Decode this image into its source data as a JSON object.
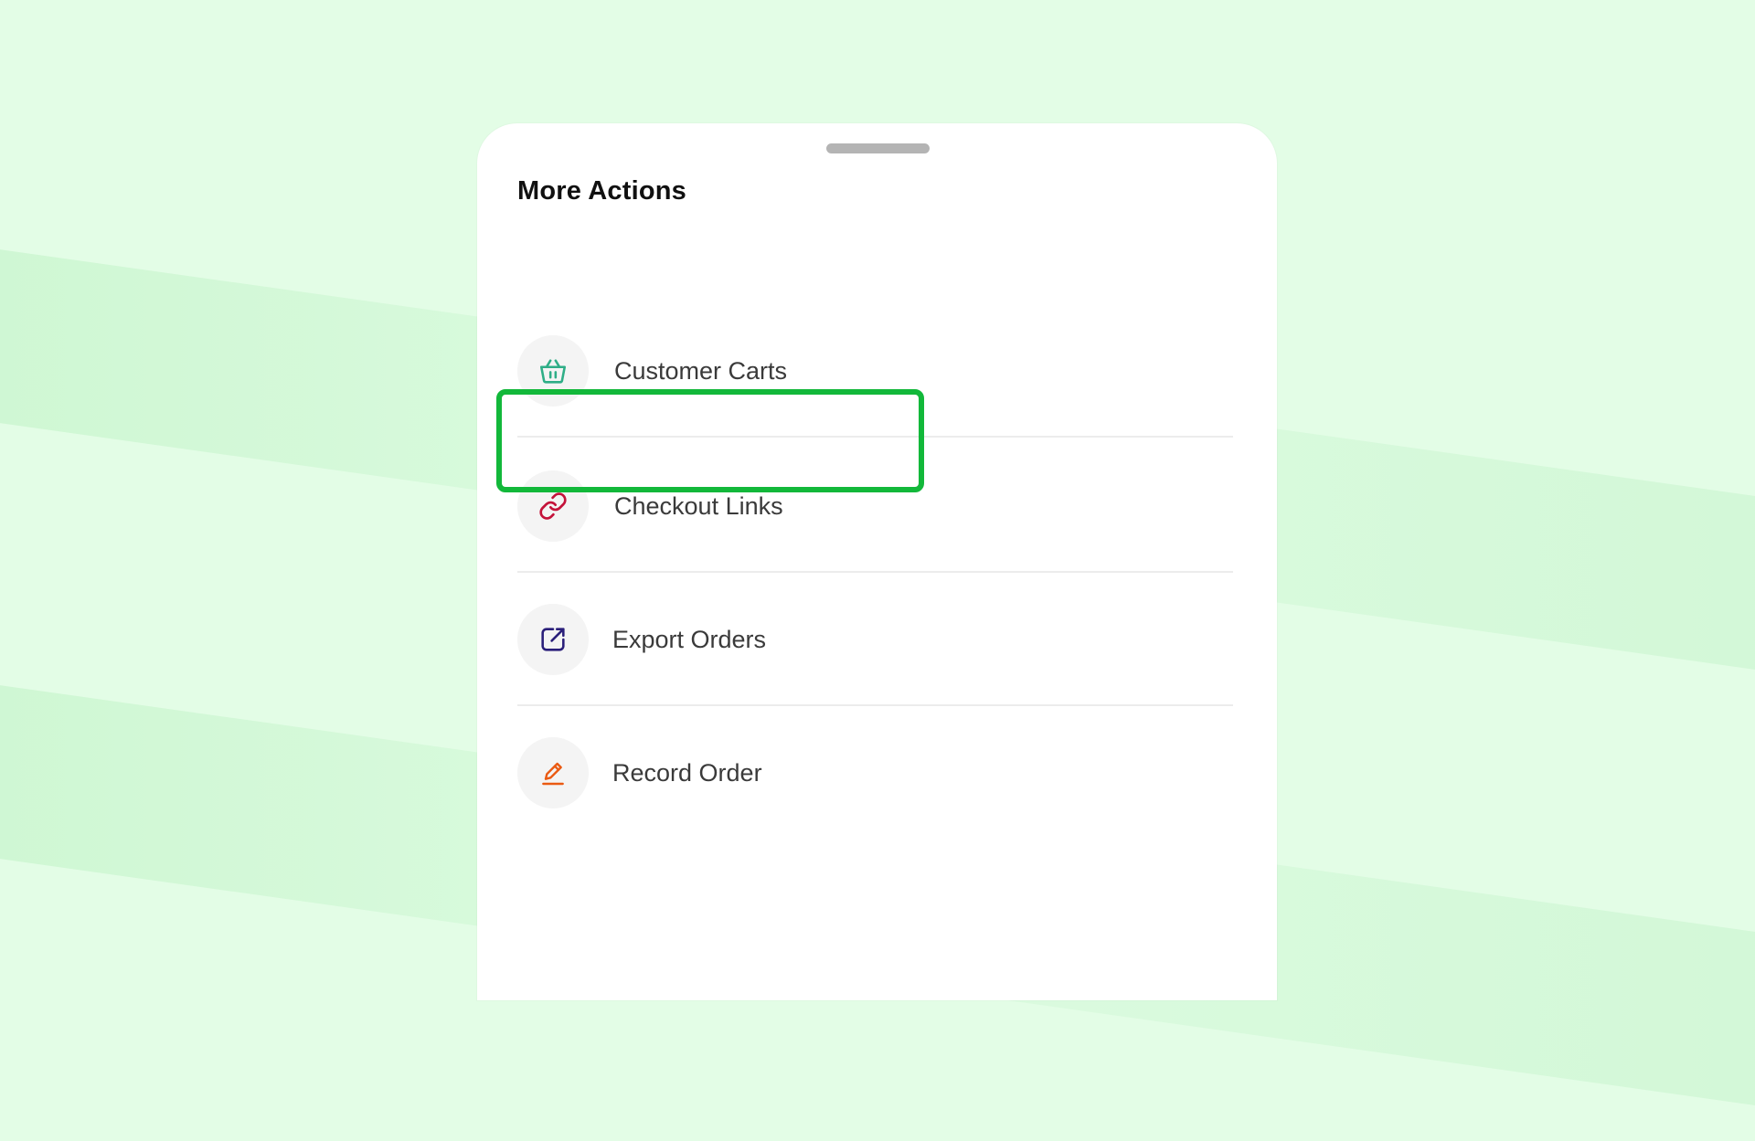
{
  "sheet": {
    "title": "More Actions"
  },
  "actions": [
    {
      "label": "Customer Carts",
      "icon": "basket-icon",
      "icon_color": "#2fae87"
    },
    {
      "label": "Checkout Links",
      "icon": "link-icon",
      "icon_color": "#c4123a",
      "highlighted": true
    },
    {
      "label": "Export Orders",
      "icon": "external-link-icon",
      "icon_color": "#2a1f7a"
    },
    {
      "label": "Record Order",
      "icon": "pen-icon",
      "icon_color": "#ea5a12"
    }
  ],
  "colors": {
    "background": "#e3fde6",
    "highlight": "#12b83a"
  }
}
